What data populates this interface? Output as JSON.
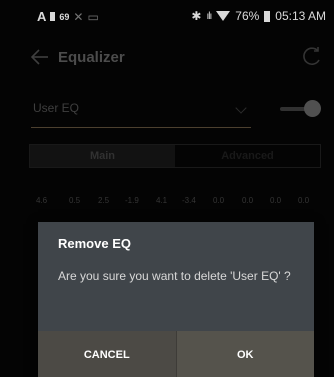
{
  "status_bar": {
    "left_number": "69",
    "battery_percent": "76%",
    "time": "05:13 AM"
  },
  "app_bar": {
    "title": "Equalizer"
  },
  "eq_select": {
    "label": "User EQ",
    "enabled": true
  },
  "tabs": [
    {
      "label": "Main",
      "selected": true
    },
    {
      "label": "Advanced",
      "selected": false
    }
  ],
  "eq_values": [
    "4.6",
    "0.5",
    "2.5",
    "-1.9",
    "4.1",
    "-3.4",
    "0.0",
    "0.0",
    "0.0",
    "0.0"
  ],
  "dialog": {
    "title": "Remove EQ",
    "message": "Are you sure you want to delete 'User EQ' ?",
    "cancel_label": "CANCEL",
    "ok_label": "OK"
  },
  "colors": {
    "dialog_bg": "#40454a",
    "button_bg": "#4c4a45",
    "select_underline": "#5a4c38"
  }
}
